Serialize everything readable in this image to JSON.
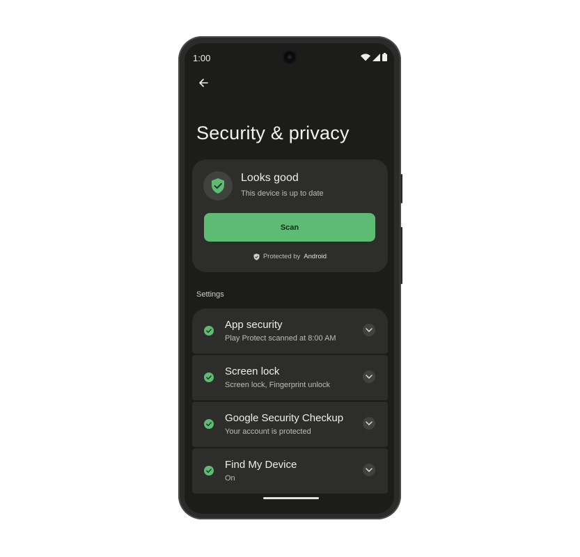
{
  "status_bar": {
    "time": "1:00",
    "icons": [
      "wifi-icon",
      "cell-signal-icon",
      "battery-icon"
    ]
  },
  "header": {
    "back_icon": "arrow-back-icon",
    "title": "Security & privacy"
  },
  "status_card": {
    "icon": "shield-check-icon",
    "title": "Looks good",
    "subtitle": "This device is up to date",
    "scan_label": "Scan",
    "protected_prefix": "Protected by",
    "protected_brand": "Android"
  },
  "settings": {
    "section_label": "Settings",
    "items": [
      {
        "title": "App security",
        "subtitle": "Play Protect scanned at 8:00 AM"
      },
      {
        "title": "Screen lock",
        "subtitle": "Screen lock, Fingerprint unlock"
      },
      {
        "title": "Google Security Checkup",
        "subtitle": "Your account is protected"
      },
      {
        "title": "Find My Device",
        "subtitle": "On"
      }
    ]
  },
  "colors": {
    "accent": "#5ebb73",
    "surface": "#2d2e2b",
    "background": "#1c1c1a"
  }
}
